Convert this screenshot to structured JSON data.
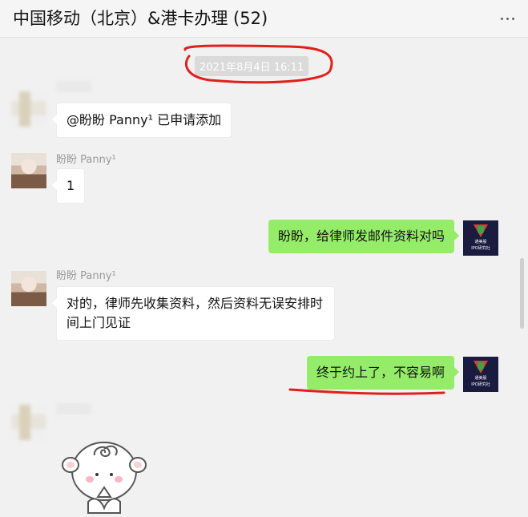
{
  "header": {
    "title": "中国移动（北京）&港卡办理 (52)",
    "more_icon": "more-icon"
  },
  "timestamp": "2021年8月4日 16:11",
  "messages": [
    {
      "direction": "in",
      "avatar": "blurred",
      "sender": "",
      "text": "@盼盼 Panny¹ 已申请添加"
    },
    {
      "direction": "in",
      "avatar": "photo",
      "sender": "盼盼 Panny¹",
      "text": "1"
    },
    {
      "direction": "out",
      "avatar": "logo",
      "text": "盼盼，给律师发邮件资料对吗"
    },
    {
      "direction": "in",
      "avatar": "photo",
      "sender": "盼盼 Panny¹",
      "text": "对的，律师先收集资料，然后资料无误安排时间上门见证"
    },
    {
      "direction": "out",
      "avatar": "logo",
      "text": "终于约上了，不容易啊"
    },
    {
      "direction": "in",
      "avatar": "blurred",
      "sender": "",
      "sticker": "cartoon-sticker"
    }
  ],
  "logo_text": [
    "通美股",
    "IPO研究社"
  ],
  "colors": {
    "outgoing_bubble": "#95ec69",
    "incoming_bubble": "#ffffff",
    "chat_background": "#f1f1f1",
    "annotation": "#e0201c"
  }
}
